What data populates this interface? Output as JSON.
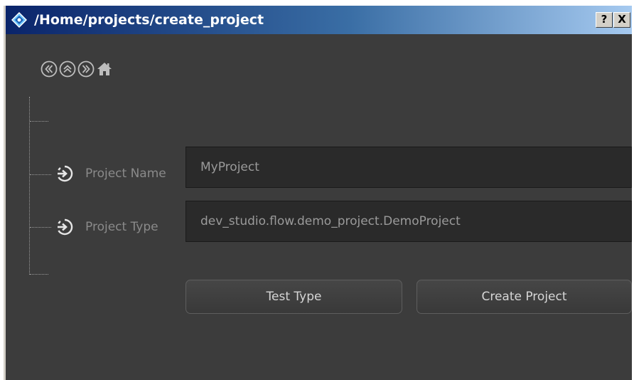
{
  "window": {
    "title": "/Home/projects/create_project",
    "help_label": "?",
    "close_label": "X"
  },
  "nav": {
    "back_icon": "circle-chevron-left-icon",
    "up_icon": "circle-chevron-up-icon",
    "forward_icon": "circle-chevron-right-icon",
    "home_icon": "home-icon"
  },
  "params": {
    "project_name": {
      "label": "Project Name",
      "value": "MyProject"
    },
    "project_type": {
      "label": "Project Type",
      "value": "dev_studio.flow.demo_project.DemoProject"
    }
  },
  "actions": {
    "test_type_label": "Test Type",
    "create_project_label": "Create Project"
  },
  "colors": {
    "background": "#3c3c3c",
    "field_bg": "#2a2a2a",
    "label_text": "#8a8a8a",
    "titlebar_start": "#0a246a",
    "titlebar_end": "#a6caf0"
  }
}
